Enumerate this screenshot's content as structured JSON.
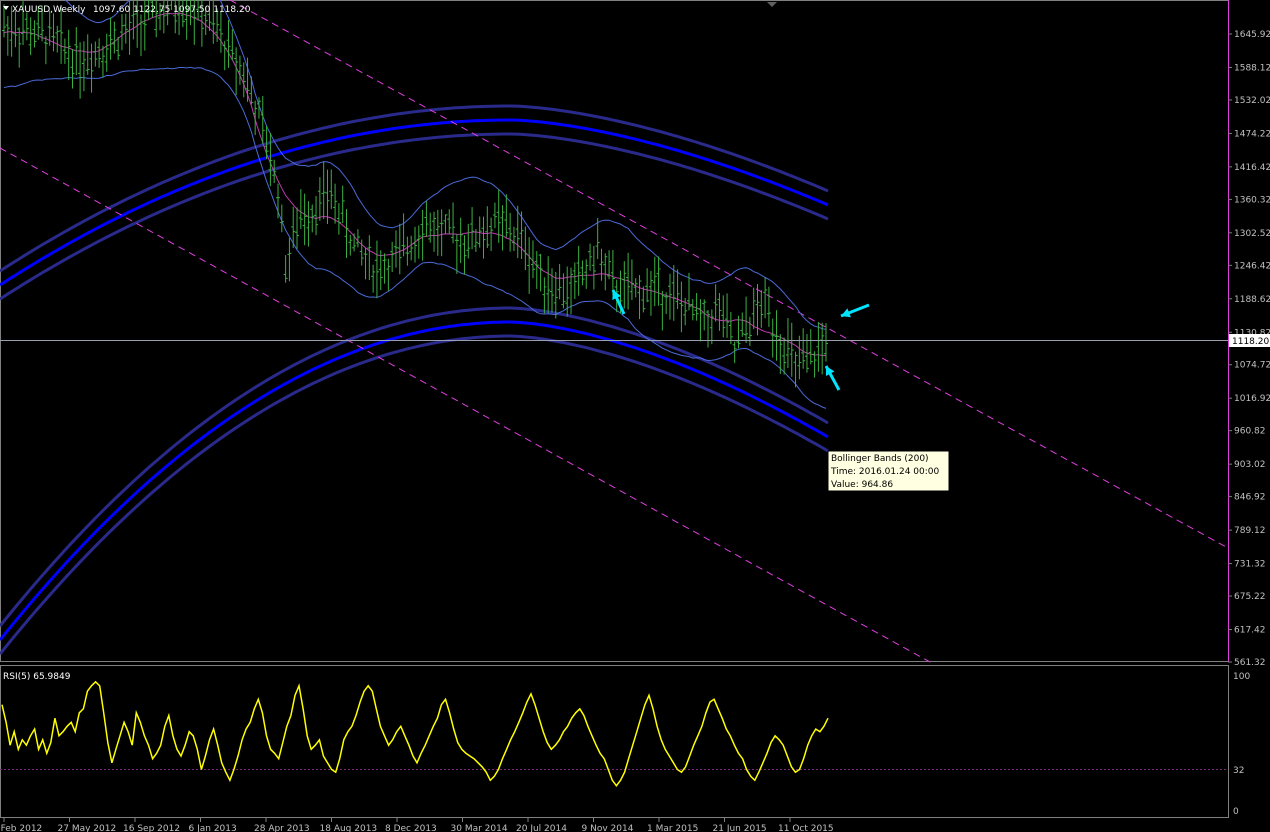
{
  "header": {
    "symbol_label": "XAUUSD,Weekly",
    "ohlc_label": "1097.60 1122.75 1097.50 1118.20"
  },
  "price_axis": {
    "ticks": [
      "1645.92",
      "1588.12",
      "1532.02",
      "1474.22",
      "1416.42",
      "1360.32",
      "1302.52",
      "1246.42",
      "1188.62",
      "1130.82",
      "1074.72",
      "1016.92",
      "960.82",
      "903.02",
      "846.92",
      "789.12",
      "731.32",
      "675.22",
      "617.42",
      "561.32"
    ],
    "current_price_label": "1118.20"
  },
  "time_axis": {
    "labels": [
      "5 Feb 2012",
      "27 May 2012",
      "16 Sep 2012",
      "6 Jan 2013",
      "28 Apr 2013",
      "18 Aug 2013",
      "8 Dec 2013",
      "30 Mar 2014",
      "20 Jul 2014",
      "9 Nov 2014",
      "1 Mar 2015",
      "21 Jun 2015",
      "11 Oct 2015"
    ]
  },
  "tooltip": {
    "line1": "Bollinger Bands (200)",
    "line2": "Time: 2016.01.24 00:00",
    "line3": "Value: 964.86"
  },
  "rsi_panel": {
    "label": "RSI(5) 65.9849",
    "axis_labels": [
      "100",
      "32",
      "0"
    ]
  },
  "colors": {
    "background": "#000000",
    "candles": "#3cb043",
    "bollinger_20": "#4a6ad8",
    "bollinger_mid": "#c03ab0",
    "bollinger_200_core": "#0000ff",
    "bollinger_200_outer": "#2a2a8c",
    "channel": "#e040e0",
    "rsi_line": "#ffff00",
    "arrows": "#00e5ff",
    "axis_text": "#c0c0c0"
  },
  "chart_data": {
    "type": "candlestick",
    "instrument": "XAUUSD",
    "timeframe": "Weekly",
    "y_range": [
      561.32,
      1690
    ],
    "last": {
      "open": 1097.6,
      "high": 1122.75,
      "low": 1097.5,
      "close": 1118.2
    },
    "price_points": [
      {
        "t": 0,
        "p": 1660
      },
      {
        "t": 12,
        "p": 1640
      },
      {
        "t": 20,
        "p": 1600
      },
      {
        "t": 30,
        "p": 1640
      },
      {
        "t": 40,
        "p": 1680
      },
      {
        "t": 48,
        "p": 1700
      },
      {
        "t": 55,
        "p": 1660
      },
      {
        "t": 63,
        "p": 1580
      },
      {
        "t": 68,
        "p": 1480
      },
      {
        "t": 72,
        "p": 1380
      },
      {
        "t": 74,
        "p": 1250
      },
      {
        "t": 78,
        "p": 1330
      },
      {
        "t": 86,
        "p": 1370
      },
      {
        "t": 92,
        "p": 1280
      },
      {
        "t": 98,
        "p": 1240
      },
      {
        "t": 104,
        "p": 1260
      },
      {
        "t": 110,
        "p": 1320
      },
      {
        "t": 116,
        "p": 1300
      },
      {
        "t": 122,
        "p": 1290
      },
      {
        "t": 130,
        "p": 1320
      },
      {
        "t": 136,
        "p": 1290
      },
      {
        "t": 140,
        "p": 1240
      },
      {
        "t": 144,
        "p": 1210
      },
      {
        "t": 148,
        "p": 1200
      },
      {
        "t": 152,
        "p": 1230
      },
      {
        "t": 156,
        "p": 1270
      },
      {
        "t": 160,
        "p": 1210
      },
      {
        "t": 166,
        "p": 1200
      },
      {
        "t": 172,
        "p": 1210
      },
      {
        "t": 178,
        "p": 1180
      },
      {
        "t": 184,
        "p": 1150
      },
      {
        "t": 188,
        "p": 1170
      },
      {
        "t": 192,
        "p": 1100
      },
      {
        "t": 196,
        "p": 1150
      },
      {
        "t": 200,
        "p": 1180
      },
      {
        "t": 204,
        "p": 1120
      },
      {
        "t": 208,
        "p": 1070
      },
      {
        "t": 212,
        "p": 1080
      },
      {
        "t": 216,
        "p": 1118
      }
    ],
    "rsi": {
      "levels": [
        0,
        32,
        100
      ],
      "values": [
        78,
        65,
        48,
        58,
        45,
        52,
        48,
        55,
        60,
        45,
        52,
        42,
        50,
        68,
        55,
        58,
        62,
        65,
        58,
        72,
        75,
        88,
        92,
        95,
        92,
        72,
        50,
        35,
        45,
        55,
        65,
        58,
        48,
        72,
        65,
        55,
        48,
        38,
        42,
        48,
        62,
        70,
        55,
        45,
        40,
        48,
        58,
        55,
        45,
        30,
        40,
        52,
        60,
        48,
        35,
        28,
        22,
        30,
        40,
        52,
        60,
        65,
        75,
        82,
        72,
        55,
        45,
        42,
        38,
        50,
        62,
        70,
        85,
        92,
        75,
        55,
        45,
        48,
        52,
        40,
        35,
        30,
        28,
        38,
        52,
        58,
        62,
        70,
        80,
        88,
        92,
        88,
        75,
        62,
        55,
        48,
        52,
        58,
        62,
        55,
        48,
        40,
        35,
        42,
        48,
        55,
        62,
        68,
        78,
        82,
        72,
        60,
        50,
        45,
        42,
        40,
        38,
        35,
        32,
        28,
        22,
        25,
        30,
        38,
        45,
        52,
        58,
        65,
        72,
        80,
        86,
        78,
        68,
        58,
        50,
        45,
        48,
        52,
        58,
        62,
        68,
        72,
        75,
        70,
        62,
        55,
        48,
        42,
        38,
        30,
        22,
        18,
        22,
        28,
        38,
        48,
        58,
        68,
        78,
        85,
        75,
        62,
        52,
        45,
        40,
        35,
        30,
        28,
        32,
        40,
        48,
        55,
        62,
        72,
        80,
        82,
        75,
        68,
        60,
        55,
        48,
        42,
        38,
        30,
        25,
        22,
        28,
        35,
        42,
        50,
        55,
        52,
        48,
        40,
        32,
        28,
        30,
        38,
        48,
        55,
        60,
        58,
        62,
        68
      ]
    },
    "series": [
      {
        "name": "Bollinger Bands (200)"
      },
      {
        "name": "RSI(5)"
      }
    ]
  }
}
